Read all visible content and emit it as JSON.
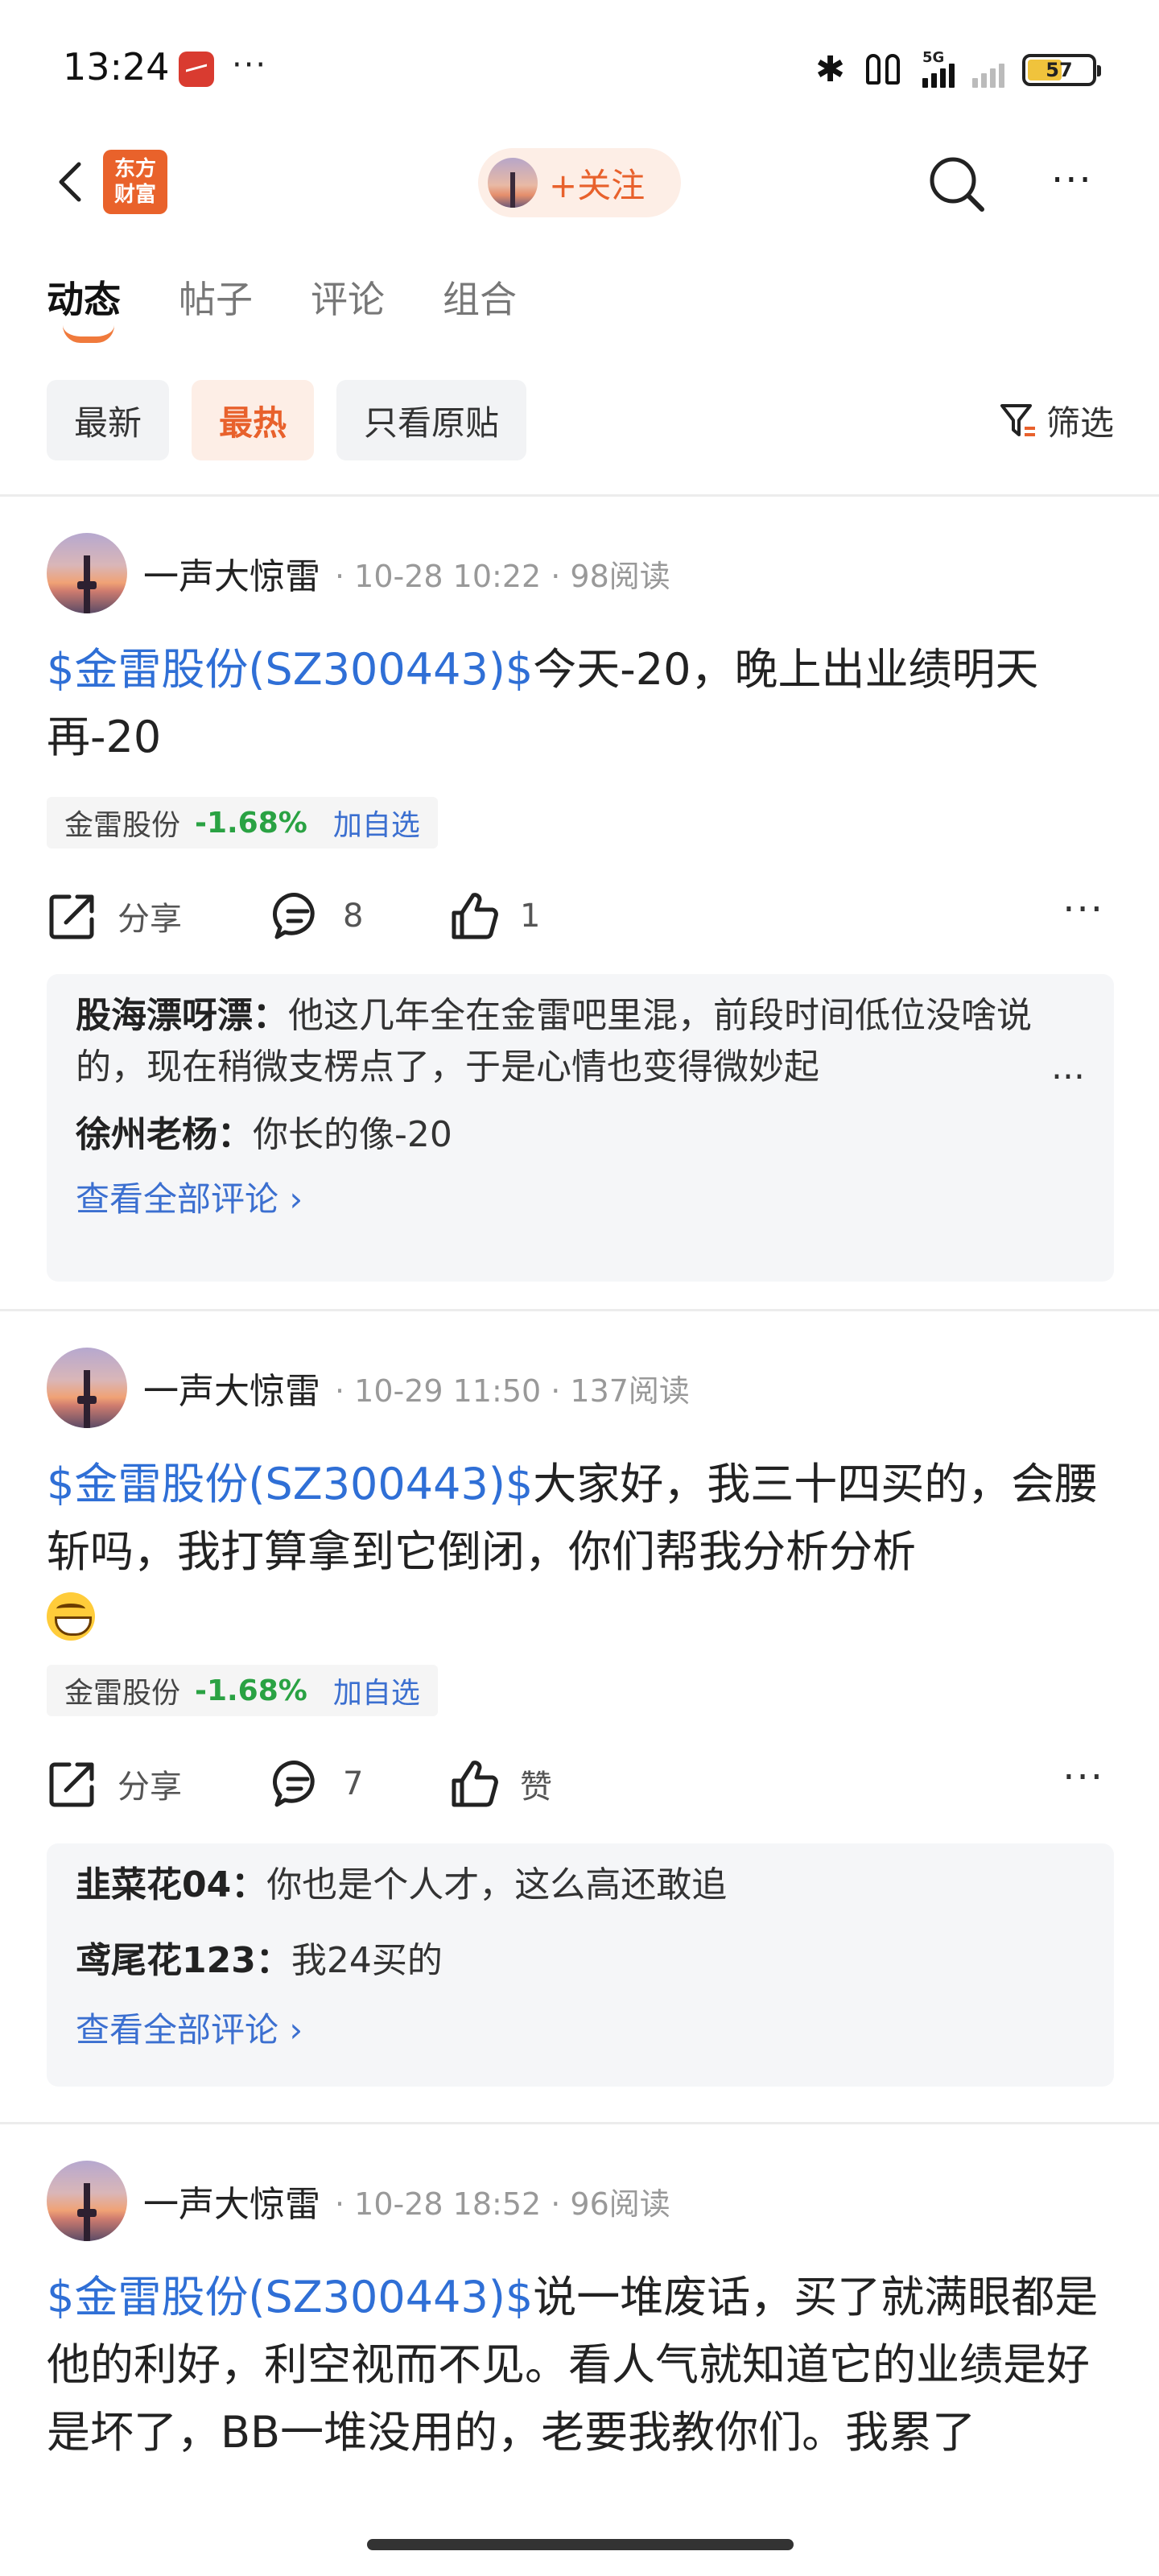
{
  "status_bar": {
    "time": "13:24",
    "dots": "···",
    "network": "5G",
    "battery": "57"
  },
  "nav": {
    "logo_text": "东方\n财富",
    "follow_label": "+关注",
    "more": "···"
  },
  "tabs": [
    {
      "label": "动态"
    },
    {
      "label": "帖子"
    },
    {
      "label": "评论"
    },
    {
      "label": "组合"
    }
  ],
  "filters": [
    {
      "label": "最新"
    },
    {
      "label": "最热"
    },
    {
      "label": "只看原贴"
    }
  ],
  "filter_button": "筛选",
  "posts": [
    {
      "author": "一声大惊雷",
      "meta": "· 10-28 10:22 · 98阅读",
      "tag": "$金雷股份(SZ300443)$",
      "text": "今天-20，晚上出业绩明天再-20",
      "stock": {
        "name": "金雷股份",
        "change": "-1.68%",
        "add": "加自选"
      },
      "share": "分享",
      "comments_count": "8",
      "likes": "1",
      "more": "···",
      "comments": [
        {
          "user": "股海漂呀漂：",
          "text": "他这几年全在金雷吧里混，前段时间低位没啥说的，现在稍微支楞点了，于是心情也变得微妙起",
          "ellipsis": "..."
        },
        {
          "user": "徐州老杨：",
          "text": "你长的像-20"
        }
      ],
      "view_all": "查看全部评论 ›"
    },
    {
      "author": "一声大惊雷",
      "meta": "· 10-29 11:50 · 137阅读",
      "tag": "$金雷股份(SZ300443)$",
      "text": "大家好，我三十四买的，会腰斩吗，我打算拿到它倒闭，你们帮我分析分析",
      "stock": {
        "name": "金雷股份",
        "change": "-1.68%",
        "add": "加自选"
      },
      "share": "分享",
      "comments_count": "7",
      "likes": "赞",
      "more": "···",
      "comments": [
        {
          "user": "韭菜花04：",
          "text": "你也是个人才，这么高还敢追"
        },
        {
          "user": "鸢尾花123：",
          "text": "我24买的"
        }
      ],
      "view_all": "查看全部评论 ›"
    },
    {
      "author": "一声大惊雷",
      "meta": "· 10-28 18:52 · 96阅读",
      "tag": "$金雷股份(SZ300443)$",
      "text": "说一堆废话，买了就满眼都是他的利好，利空视而不见。看人气就知道它的业绩是好是坏了，BB一堆没用的，老要我教你们。我累了"
    }
  ]
}
